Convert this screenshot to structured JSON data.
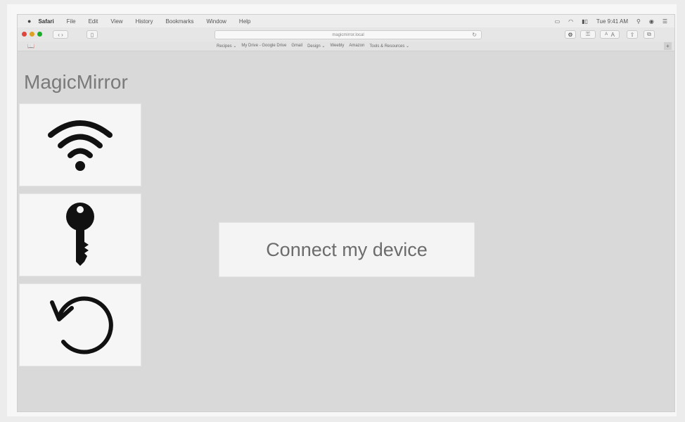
{
  "menubar": {
    "app": "Safari",
    "items": [
      "File",
      "Edit",
      "View",
      "History",
      "Bookmarks",
      "Window",
      "Help"
    ],
    "clock": "Tue 9:41 AM"
  },
  "toolbar": {
    "url": "magicmirror.local",
    "font_small": "A",
    "font_large": "A"
  },
  "bookmarks": {
    "items": [
      "Recipes ⌄",
      "My Drive - Google Drive",
      "Gmail",
      "Design ⌄",
      "Weebly",
      "Amazon",
      "Tools & Resources ⌄"
    ]
  },
  "app": {
    "title": "MagicMirror",
    "connect_label": "Connect my device"
  },
  "icons": {
    "wifi": "wifi-icon",
    "key": "key-icon",
    "reset": "reset-icon"
  },
  "colors": {
    "background": "#d9d9d9",
    "button": "#f4f4f4",
    "icon": "#111111"
  }
}
